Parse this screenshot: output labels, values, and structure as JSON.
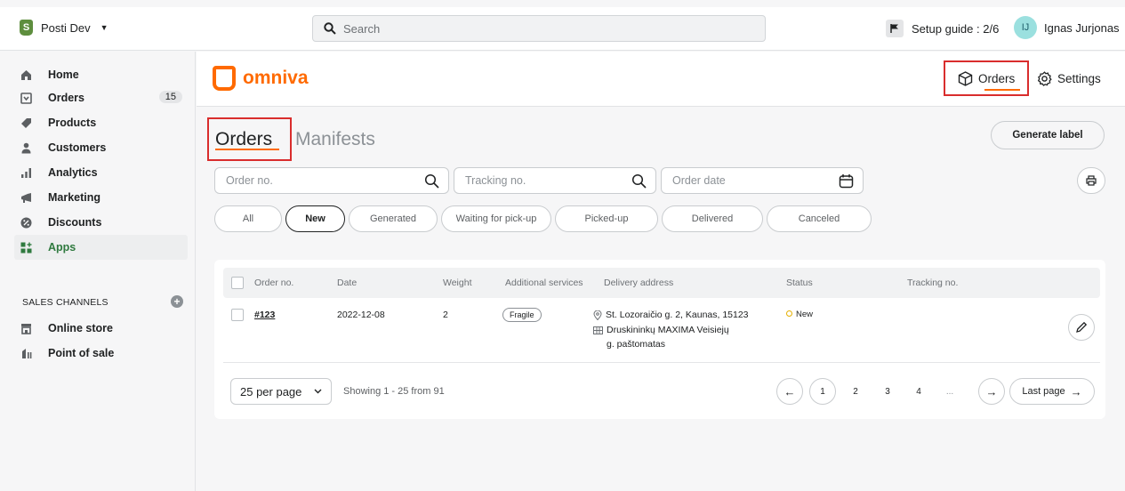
{
  "topbar": {
    "store_name": "Posti Dev",
    "search_placeholder": "Search",
    "setup_guide": "Setup guide : 2/6",
    "user_initials": "IJ",
    "user_name": "Ignas Jurjonas"
  },
  "sidebar": {
    "items": [
      {
        "label": "Home",
        "icon": "home-icon"
      },
      {
        "label": "Orders",
        "icon": "orders-icon",
        "count": "15"
      },
      {
        "label": "Products",
        "icon": "tag-icon"
      },
      {
        "label": "Customers",
        "icon": "person-icon"
      },
      {
        "label": "Analytics",
        "icon": "bar-chart-icon"
      },
      {
        "label": "Marketing",
        "icon": "megaphone-icon"
      },
      {
        "label": "Discounts",
        "icon": "discount-icon"
      },
      {
        "label": "Apps",
        "icon": "apps-icon"
      }
    ],
    "sales_channels_label": "SALES CHANNELS",
    "channels": [
      {
        "label": "Online store",
        "icon": "store-icon"
      },
      {
        "label": "Point of sale",
        "icon": "pos-icon"
      }
    ]
  },
  "app": {
    "brand": "omniva",
    "nav_orders": "Orders",
    "nav_settings": "Settings",
    "tab_orders": "Orders",
    "tab_manifests": "Manifests",
    "generate_label": "Generate label",
    "filters": {
      "order_no_placeholder": "Order no.",
      "tracking_placeholder": "Tracking no.",
      "date_placeholder": "Order date"
    },
    "status_chips": [
      "All",
      "New",
      "Generated",
      "Waiting for pick-up",
      "Picked-up",
      "Delivered",
      "Canceled"
    ],
    "active_chip": "New",
    "table": {
      "columns": [
        "Order no.",
        "Date",
        "Weight",
        "Additional services",
        "Delivery address",
        "Status",
        "Tracking no."
      ],
      "rows": [
        {
          "order_no": "#123",
          "date": "2022-12-08",
          "weight": "2",
          "service": "Fragile",
          "address_line1": "St. Lozoraičio g. 2, Kaunas, 15123",
          "address_line2": "Druskininkų MAXIMA Veisiejų",
          "address_line3": "g. paštomatas",
          "status": "New",
          "tracking_no": ""
        }
      ]
    },
    "pagination": {
      "per_page": "25 per page",
      "showing": "Showing 1 - 25 from 91",
      "pages": [
        "1",
        "2",
        "3",
        "4",
        "..."
      ],
      "current_page": "1",
      "last_page": "Last page"
    },
    "colors": {
      "accent": "#ff6a00",
      "highlight_border": "#d92d2d",
      "status_new": "#e5b000"
    }
  }
}
